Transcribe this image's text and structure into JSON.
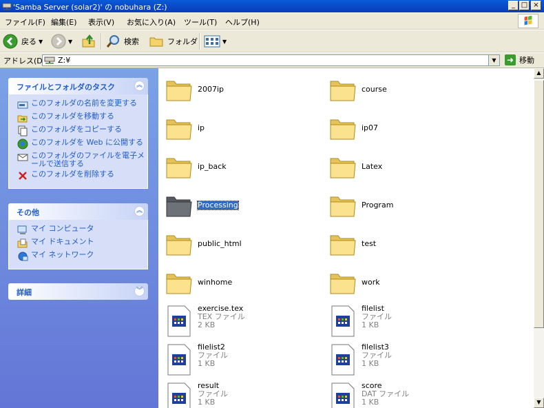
{
  "window": {
    "title": "'Samba Server (solar2)' の nobuhara (Z:)"
  },
  "menu": [
    {
      "label": "ファイル(F)"
    },
    {
      "label": "編集(E)"
    },
    {
      "label": "表示(V)"
    },
    {
      "label": "お気に入り(A)"
    },
    {
      "label": "ツール(T)"
    },
    {
      "label": "ヘルプ(H)"
    }
  ],
  "toolbar": {
    "back_label": "戻る",
    "search_label": "検索",
    "folders_label": "フォルダ"
  },
  "address": {
    "label": "アドレス(D)",
    "value": "Z:¥",
    "go_label": "移動"
  },
  "tasks": {
    "title": "ファイルとフォルダのタスク",
    "items": [
      {
        "label": "このフォルダの名前を変更する",
        "icon": "rename-icon"
      },
      {
        "label": "このフォルダを移動する",
        "icon": "move-icon"
      },
      {
        "label": "このフォルダをコピーする",
        "icon": "copy-icon"
      },
      {
        "label": "このフォルダを Web に公開する",
        "icon": "publish-icon"
      },
      {
        "label": "このフォルダのファイルを電子メールで送信する",
        "icon": "email-icon"
      },
      {
        "label": "このフォルダを削除する",
        "icon": "delete-icon"
      }
    ]
  },
  "other": {
    "title": "その他",
    "items": [
      {
        "label": "マイ コンピュータ",
        "icon": "my-computer-icon"
      },
      {
        "label": "マイ ドキュメント",
        "icon": "my-documents-icon"
      },
      {
        "label": "マイ ネットワーク",
        "icon": "my-network-icon"
      }
    ]
  },
  "details": {
    "title": "詳細"
  },
  "files": [
    {
      "name": "2007ip",
      "type": "folder"
    },
    {
      "name": "course",
      "type": "folder"
    },
    {
      "name": "ip",
      "type": "folder"
    },
    {
      "name": "ip07",
      "type": "folder"
    },
    {
      "name": "ip_back",
      "type": "folder"
    },
    {
      "name": "Latex",
      "type": "folder"
    },
    {
      "name": "Processing",
      "type": "folder",
      "selected": true
    },
    {
      "name": "Program",
      "type": "folder"
    },
    {
      "name": "public_html",
      "type": "folder"
    },
    {
      "name": "test",
      "type": "folder"
    },
    {
      "name": "winhome",
      "type": "folder"
    },
    {
      "name": "work",
      "type": "folder"
    },
    {
      "name": "exercise.tex",
      "type": "file",
      "kind": "TEX ファイル",
      "size": "2 KB"
    },
    {
      "name": "filelist",
      "type": "file",
      "kind": "ファイル",
      "size": "1 KB"
    },
    {
      "name": "filelist2",
      "type": "file",
      "kind": "ファイル",
      "size": "1 KB"
    },
    {
      "name": "filelist3",
      "type": "file",
      "kind": "ファイル",
      "size": "1 KB"
    },
    {
      "name": "result",
      "type": "file",
      "kind": "ファイル",
      "size": "1 KB"
    },
    {
      "name": "score",
      "type": "file",
      "kind": "DAT ファイル",
      "size": "1 KB"
    }
  ],
  "colors": {
    "title_bar": "#0a47c5",
    "task_link": "#215dc6",
    "pane_bg": "#7ba2e7",
    "selection": "#316ac5"
  }
}
